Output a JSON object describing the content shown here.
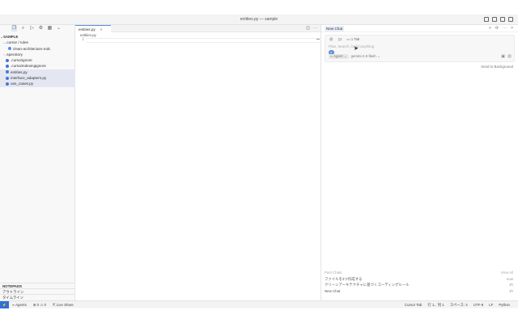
{
  "window": {
    "title": "entities.py — sample"
  },
  "activity_icons": [
    "files-icon",
    "search-icon",
    "run-debug-icon",
    "extensions-icon",
    "grid-icon",
    "chevron-down-icon"
  ],
  "explorer": {
    "root": "SAMPLE",
    "items": [
      {
        "label": ".cursor / rules",
        "depth": 1,
        "caret": "v",
        "color": "",
        "selected": false
      },
      {
        "label": "clean-architecture.mdc",
        "depth": 2,
        "caret": "",
        "color": "#4a90e2",
        "selected": false
      },
      {
        "label": ".specstory",
        "depth": 1,
        "caret": ">",
        "color": "",
        "selected": false
      },
      {
        "label": ".cursorignore",
        "depth": 1,
        "caret": "",
        "color": "#4a6fd6",
        "selected": false
      },
      {
        "label": ".cursorindexingignore",
        "depth": 1,
        "caret": "",
        "color": "#4a6fd6",
        "selected": false
      },
      {
        "label": "entities.py",
        "depth": 1,
        "caret": "",
        "color": "#3b7bd6",
        "selected": true
      },
      {
        "label": "interface_adapters.py",
        "depth": 1,
        "caret": "",
        "color": "#3b7bd6",
        "selected": true
      },
      {
        "label": "use_cases.py",
        "depth": 1,
        "caret": "",
        "color": "#3b7bd6",
        "selected": true
      }
    ],
    "bottom": {
      "notepads": "NOTEPADS",
      "outline": "アウトライン",
      "timeline": "タイムライン"
    }
  },
  "editor": {
    "tab_label": "entities.py",
    "tab_close": "×",
    "breadcrumb": "entities.py",
    "line_number": "1"
  },
  "chat": {
    "tab_label": "New Chat",
    "icons": [
      "+",
      "⟳",
      "⋯",
      "×"
    ],
    "ctx_at": "@",
    "ctx_files": "1",
    "ctx_tab": "1 Tab",
    "placeholder": "Plan, search, build anything",
    "agent_label": "∞ Agent",
    "agent_caret": "⌄",
    "model_label": "gemini-2.5-flash",
    "model_caret": "⌄",
    "send_bg": "Send to Background",
    "footer": {
      "header_left": "Past Chats",
      "header_right": "View All",
      "rows": [
        {
          "label": "ファイルを3つ作成する",
          "key": "now"
        },
        {
          "label": "クリーンアーキテクチャに基づくコーディングルール",
          "key": "2h"
        },
        {
          "label": "New Chat",
          "key": "4h"
        }
      ]
    }
  },
  "statusbar": {
    "remote": "⚡",
    "agents": "∞ Agents",
    "problems": "⊗ 0 ⚠ 0",
    "live_share": "Live Share",
    "right": [
      "Cursor Tab",
      "行 1、列 1",
      "スペース: 4",
      "UTF-8",
      "LF",
      "Python"
    ]
  },
  "colors": {
    "accent": "#2f6fd6",
    "selection": "#e4e6f1"
  }
}
